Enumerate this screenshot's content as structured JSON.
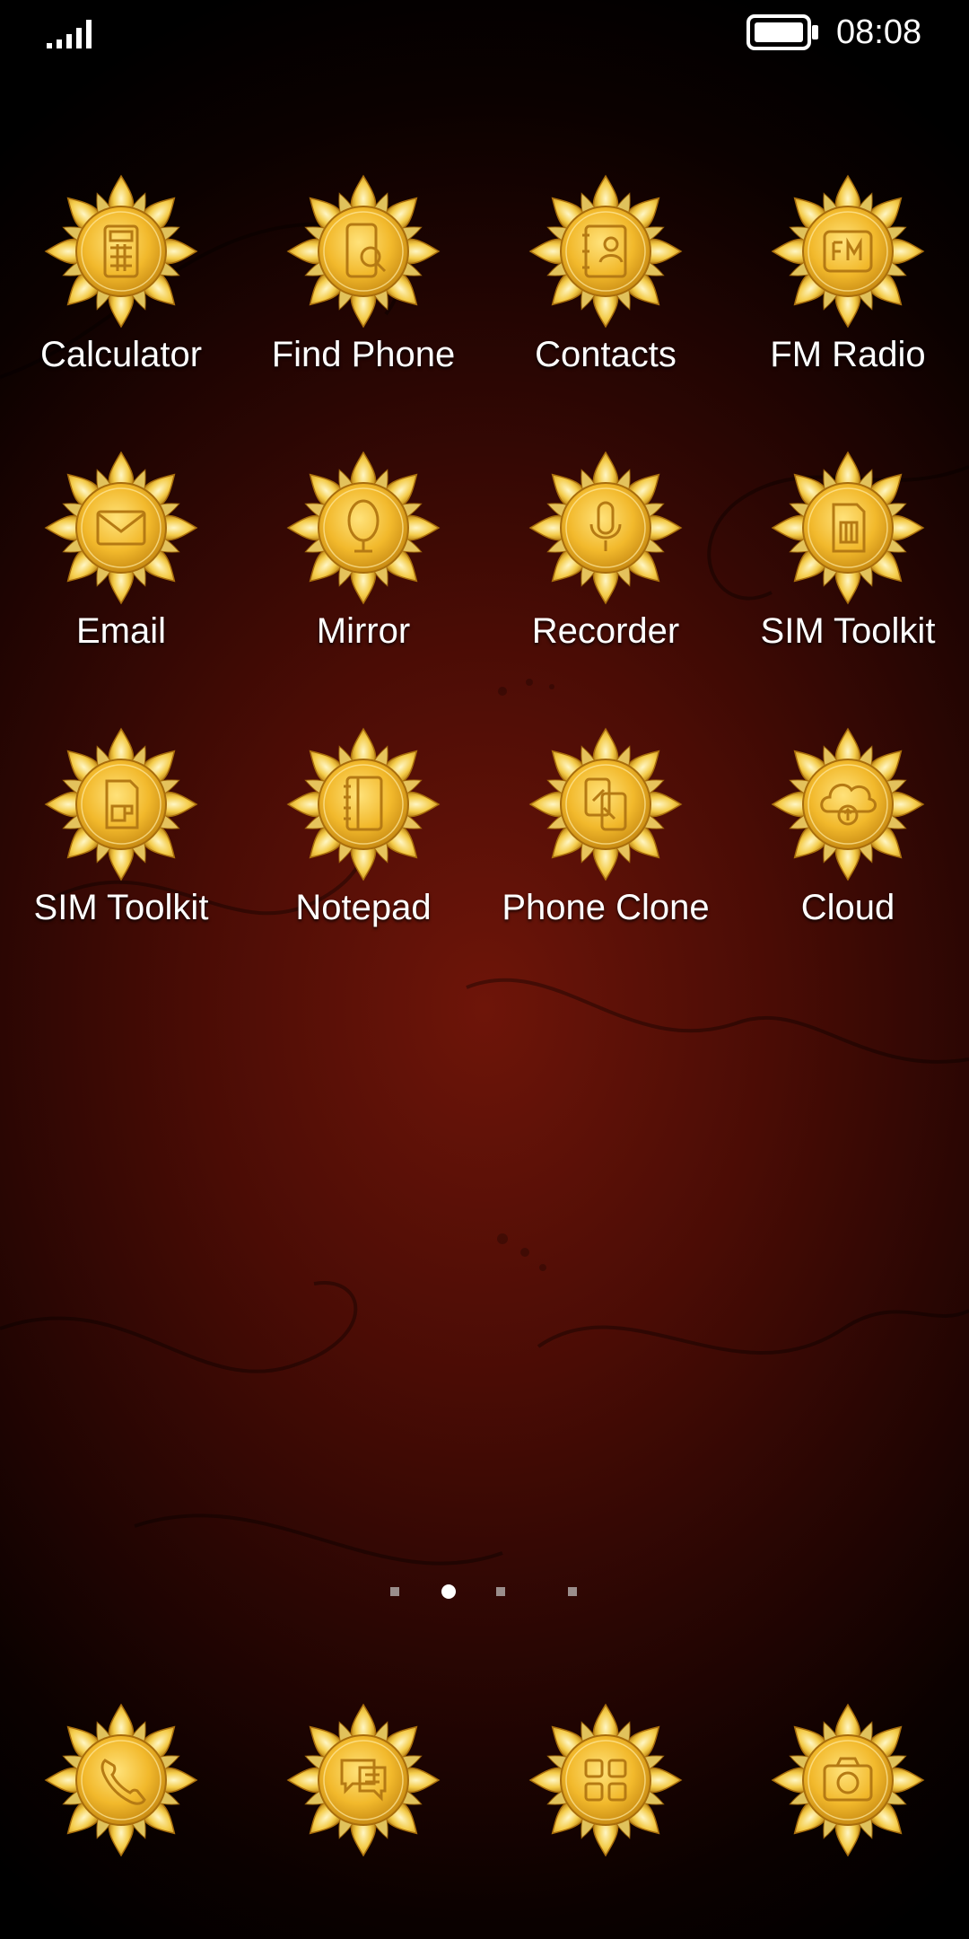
{
  "status_bar": {
    "time": "08:08",
    "signal_icon": "signal-bars-icon",
    "battery_icon": "battery-full-icon"
  },
  "theme": {
    "gold_light": "#fff2a8",
    "gold_mid": "#f2c23a",
    "gold_dark": "#b07a12",
    "wallpaper_red": "#6e1509"
  },
  "apps": [
    {
      "label": "Calculator",
      "icon": "calculator-icon"
    },
    {
      "label": "Find Phone",
      "icon": "find-phone-icon"
    },
    {
      "label": "Contacts",
      "icon": "contacts-icon"
    },
    {
      "label": "FM Radio",
      "icon": "fm-radio-icon"
    },
    {
      "label": "Email",
      "icon": "email-icon"
    },
    {
      "label": "Mirror",
      "icon": "mirror-icon"
    },
    {
      "label": "Recorder",
      "icon": "recorder-icon"
    },
    {
      "label": "SIM Toolkit",
      "icon": "sim-toolkit-icon"
    },
    {
      "label": "SIM Toolkit",
      "icon": "sim-toolkit-icon"
    },
    {
      "label": "Notepad",
      "icon": "notepad-icon"
    },
    {
      "label": "Phone Clone",
      "icon": "phone-clone-icon"
    },
    {
      "label": "Cloud",
      "icon": "cloud-icon"
    }
  ],
  "page_indicator": {
    "pages": 4,
    "current": 2
  },
  "dock": [
    {
      "icon": "phone-icon"
    },
    {
      "icon": "messages-icon"
    },
    {
      "icon": "app-drawer-icon"
    },
    {
      "icon": "camera-icon"
    }
  ]
}
